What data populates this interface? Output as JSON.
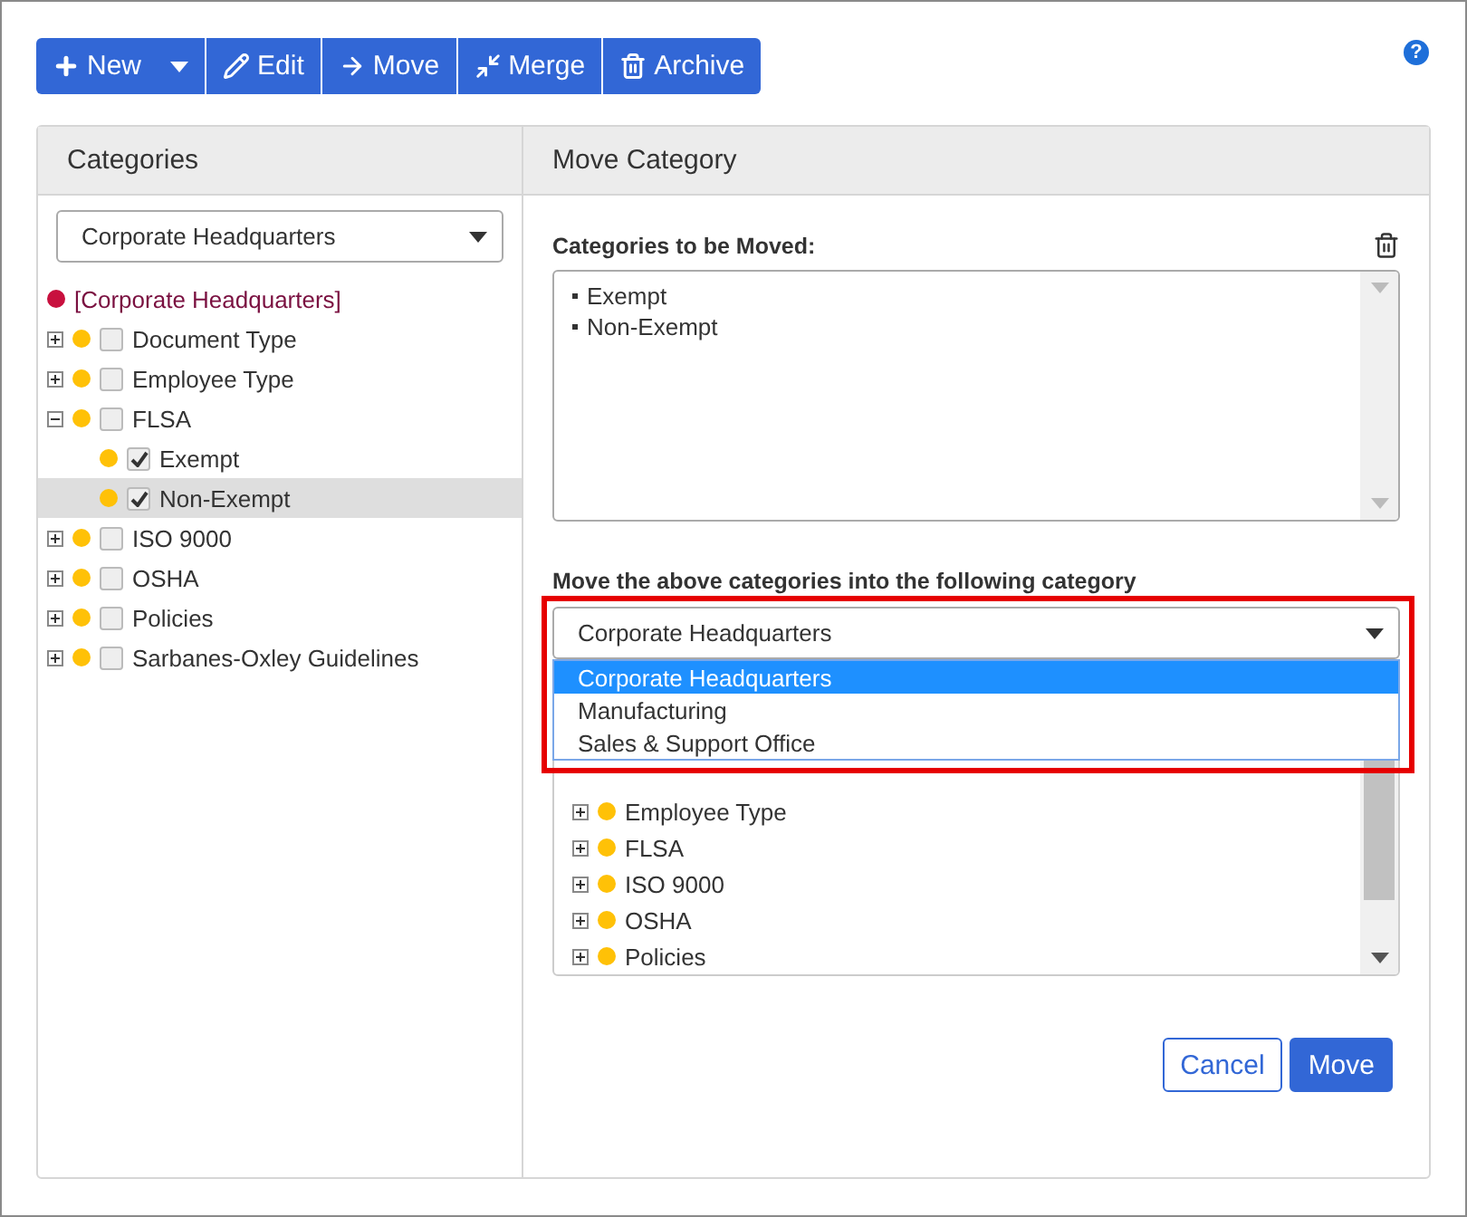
{
  "help": "?",
  "toolbar": {
    "buttons": [
      {
        "label": "New",
        "kind": "split"
      },
      {
        "label": "Edit",
        "kind": "plain"
      },
      {
        "label": "Move",
        "kind": "plain"
      },
      {
        "label": "Merge",
        "kind": "plain"
      },
      {
        "label": "Archive",
        "kind": "plain"
      }
    ]
  },
  "categories": {
    "title": "Categories",
    "select": {
      "value": "Corporate Headquarters"
    },
    "tree": [
      {
        "label": "[Corporate Headquarters]",
        "kind": "root",
        "color": "#c8103e",
        "children": [
          {
            "label": "Document Type",
            "kind": "node",
            "color": "#ffc107",
            "expanded": false,
            "checked": false,
            "selected": false
          },
          {
            "label": "Employee Type",
            "kind": "node",
            "color": "#ffc107",
            "expanded": false,
            "checked": false,
            "selected": false
          },
          {
            "label": "FLSA",
            "kind": "node",
            "color": "#ffc107",
            "expanded": true,
            "checked": false,
            "selected": false,
            "children": [
              {
                "label": "Exempt",
                "kind": "leaf",
                "color": "#ffc107",
                "checked": true,
                "selected": false
              },
              {
                "label": "Non-Exempt",
                "kind": "leaf",
                "color": "#ffc107",
                "checked": true,
                "selected": true
              }
            ]
          },
          {
            "label": "ISO 9000",
            "kind": "node",
            "color": "#ffc107",
            "expanded": false,
            "checked": false,
            "selected": false
          },
          {
            "label": "OSHA",
            "kind": "node",
            "color": "#ffc107",
            "expanded": false,
            "checked": false,
            "selected": false
          },
          {
            "label": "Policies",
            "kind": "node",
            "color": "#ffc107",
            "expanded": false,
            "checked": false,
            "selected": false
          },
          {
            "label": "Sarbanes-Oxley Guidelines",
            "kind": "node",
            "color": "#ffc107",
            "expanded": false,
            "checked": false,
            "selected": false
          }
        ]
      }
    ]
  },
  "move_category": {
    "title": "Move Category",
    "moved_label": "Categories to be Moved:",
    "moved_items": [
      "Exempt",
      "Non-Exempt"
    ],
    "target_label": "Move the above categories into the following category",
    "target_select": {
      "value": "Corporate Headquarters"
    },
    "dropdown_options": [
      {
        "label": "Corporate Headquarters",
        "selected": true
      },
      {
        "label": "Manufacturing",
        "selected": false
      },
      {
        "label": "Sales & Support Office",
        "selected": false
      }
    ],
    "target_tree": [
      {
        "label": "Employee Type",
        "color": "#ffc107",
        "expanded": false
      },
      {
        "label": "FLSA",
        "color": "#ffc107",
        "expanded": false
      },
      {
        "label": "ISO 9000",
        "color": "#ffc107",
        "expanded": false
      },
      {
        "label": "OSHA",
        "color": "#ffc107",
        "expanded": false
      },
      {
        "label": "Policies",
        "color": "#ffc107",
        "expanded": false
      }
    ],
    "buttons": [
      {
        "label": "Cancel",
        "kind": "secondary"
      },
      {
        "label": "Move",
        "kind": "primary"
      }
    ]
  }
}
